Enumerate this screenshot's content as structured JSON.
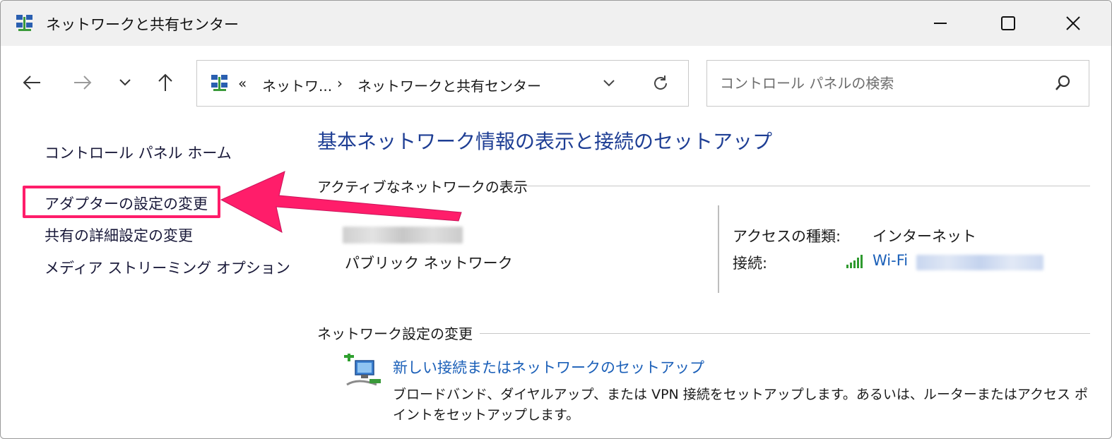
{
  "window": {
    "title": "ネットワークと共有センター"
  },
  "nav": {
    "breadcrumb_overflow": "«",
    "breadcrumb_parent": "ネットワ...",
    "breadcrumb_sep": "›",
    "breadcrumb_current": "ネットワークと共有センター"
  },
  "search": {
    "placeholder": "コントロール パネルの検索"
  },
  "sidebar": {
    "items": [
      {
        "label": "コントロール パネル ホーム"
      },
      {
        "label": "アダプターの設定の変更"
      },
      {
        "label": "共有の詳細設定の変更"
      },
      {
        "label": "メディア ストリーミング オプション"
      }
    ]
  },
  "main": {
    "title": "基本ネットワーク情報の表示と接続のセットアップ",
    "active_section": "アクティブなネットワークの表示",
    "network_type": "パブリック ネットワーク",
    "access_type_label": "アクセスの種類:",
    "access_type_value": "インターネット",
    "connection_label": "接続:",
    "connection_value": "Wi-Fi",
    "change_section": "ネットワーク設定の変更",
    "setup_link": "新しい接続またはネットワークのセットアップ",
    "setup_desc": "ブロードバンド、ダイヤルアップ、または VPN 接続をセットアップします。あるいは、ルーターまたはアクセス ポイントをセットアップします。"
  },
  "colors": {
    "annotation": "#ff1d6a",
    "link": "#1a5fb8",
    "title": "#1e3e94"
  },
  "icons": {
    "network": "network-center-icon",
    "search": "search-icon",
    "refresh": "refresh-icon",
    "signal": "wifi-signal-icon",
    "setup": "new-connection-icon"
  }
}
